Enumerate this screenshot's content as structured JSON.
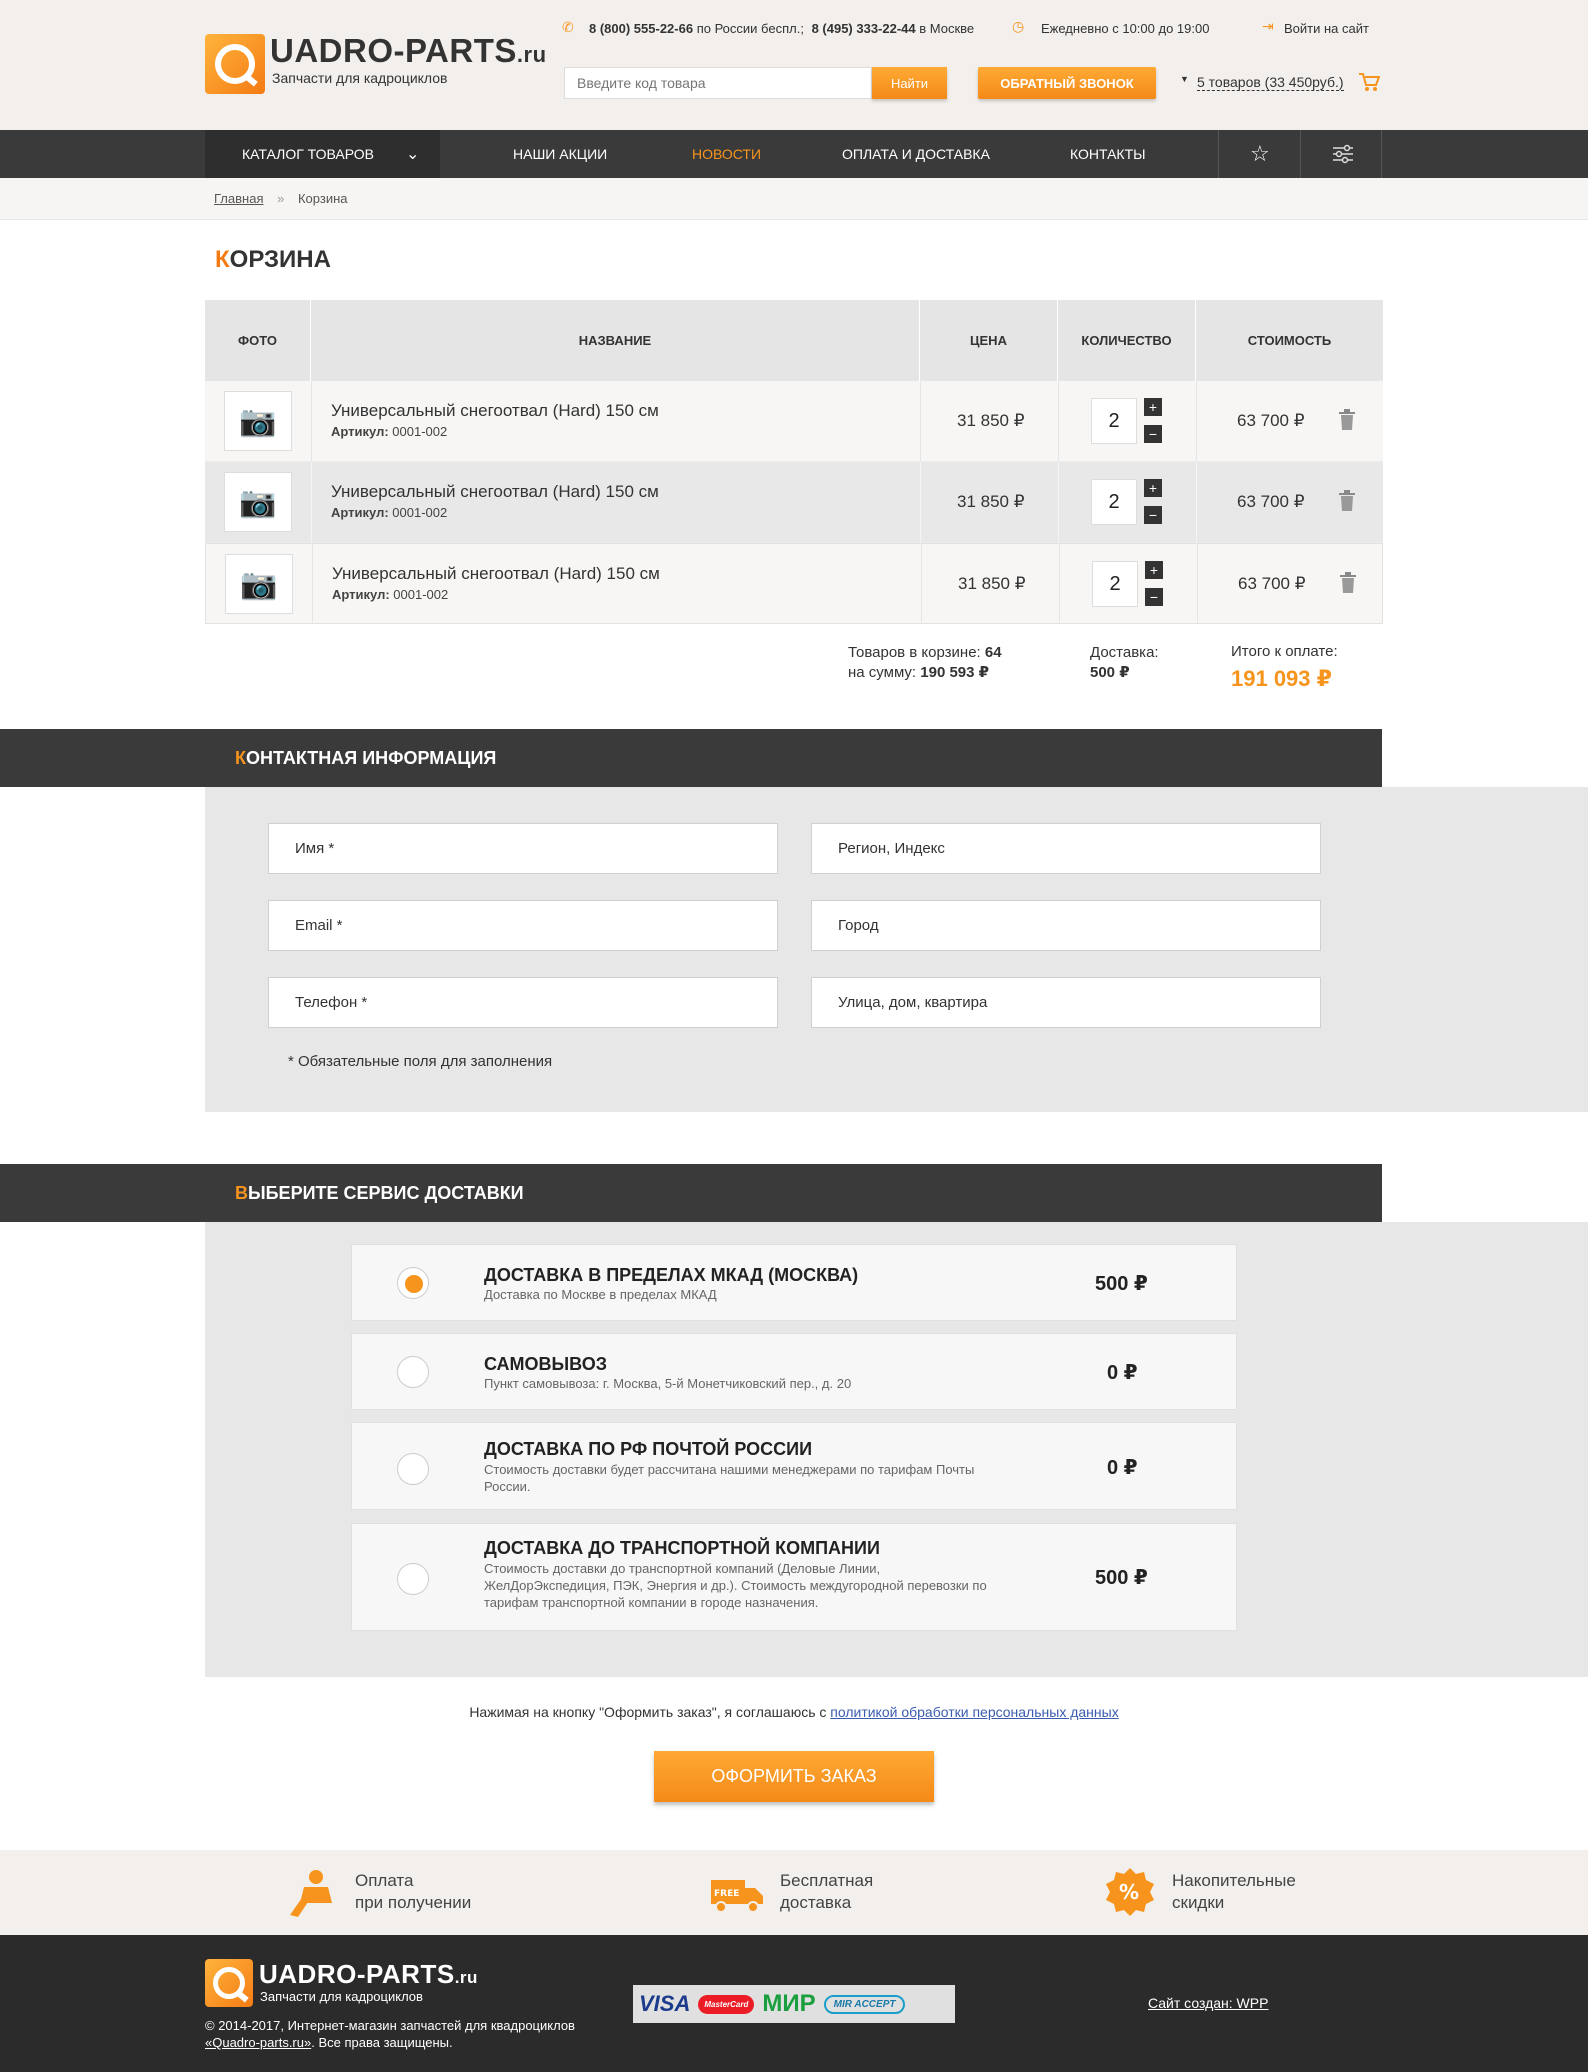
{
  "header": {
    "logo_title": "UADRO-PARTS",
    "logo_tld": ".ru",
    "logo_sub": "Запчасти для кадроциклов",
    "phone1": "8 (800) 555-22-66",
    "phone1_note": "по России беспл.;",
    "phone2": "8 (495) 333-22-44",
    "phone2_note": "в Москве",
    "hours": "Ежедневно с 10:00 до 19:00",
    "login": "Войти на сайт",
    "search_placeholder": "Введите код товара",
    "search_button": "Найти",
    "callback_button": "ОБРАТНЫЙ ЗВОНОК",
    "cart_summary": "5 товаров (33 450руб.)"
  },
  "nav": {
    "catalog": "КАТАЛОГ ТОВАРОВ",
    "items": [
      "НАШИ АКЦИИ",
      "НОВОСТИ",
      "ОПЛАТА И ДОСТАВКА",
      "КОНТАКТЫ"
    ]
  },
  "breadcrumb": {
    "home": "Главная",
    "sep": "»",
    "current": "Корзина"
  },
  "cart": {
    "title_first": "К",
    "title_rest": "ОРЗИНА",
    "headers": [
      "ФОТО",
      "НАЗВАНИЕ",
      "ЦЕНА",
      "КОЛИЧЕСТВО",
      "СТОИМОСТЬ"
    ],
    "rows": [
      {
        "name": "Универсальный снегоотвал (Hard) 150 см",
        "sku_label": "Артикул:",
        "sku": "0001-002",
        "price": "31 850 ₽",
        "qty": "2",
        "total": "63 700 ₽"
      },
      {
        "name": "Универсальный снегоотвал (Hard) 150 см",
        "sku_label": "Артикул:",
        "sku": "0001-002",
        "price": "31 850 ₽",
        "qty": "2",
        "total": "63 700 ₽"
      },
      {
        "name": "Универсальный снегоотвал (Hard) 150 см",
        "sku_label": "Артикул:",
        "sku": "0001-002",
        "price": "31 850 ₽",
        "qty": "2",
        "total": "63 700 ₽"
      }
    ],
    "summary": {
      "items_label": "Товаров в корзине:",
      "items_count": "64",
      "sum_label": "на сумму:",
      "sum_value": "190 593 ₽",
      "delivery_label": "Доставка:",
      "delivery_value": "500 ₽",
      "total_label": "Итого к оплате:",
      "total_value": "191 093 ₽"
    }
  },
  "contact": {
    "title_first": "К",
    "title_rest": "ОНТАКТНАЯ ИНФОРМАЦИЯ",
    "fields": [
      "Имя *",
      "Регион, Индекс",
      "Email *",
      "Город",
      "Телефон *",
      "Улица, дом, квартира"
    ],
    "note": "* Обязательные поля для заполнения"
  },
  "delivery": {
    "title_first": "В",
    "title_rest": "ЫБЕРИТЕ СЕРВИС ДОСТАВКИ",
    "options": [
      {
        "title": "ДОСТАВКА В ПРЕДЕЛАХ МКАД (МОСКВА)",
        "desc": "Доставка по Москве в пределах МКАД",
        "price": "500 ₽",
        "selected": true
      },
      {
        "title": "САМОВЫВОЗ",
        "desc": "Пункт самовывоза: г. Москва, 5-й Монетчиковский пер., д. 20",
        "price": "0 ₽",
        "selected": false
      },
      {
        "title": "ДОСТАВКА ПО РФ ПОЧТОЙ РОССИИ",
        "desc": "Стоимость доставки будет рассчитана нашими менеджерами по тарифам Почты России.",
        "price": "0 ₽",
        "selected": false
      },
      {
        "title": "ДОСТАВКА ДО ТРАНСПОРТНОЙ КОМПАНИИ",
        "desc": "Стоимость доставки до транспортной компаний (Деловые Линии, ЖелДорЭкспедиция, ПЭК, Энергия и др.). Стоимость междугородной перевозки по тарифам транспортной компании в городе назначения.",
        "price": "500 ₽",
        "selected": false
      }
    ]
  },
  "agreement": {
    "text": "Нажимая на кнопку \"Оформить заказ\", я соглашаюсь с",
    "link": "политикой обработки персональных данных"
  },
  "order_button": "ОФОРМИТЬ ЗАКАЗ",
  "benefits": [
    {
      "line1": "Оплата",
      "line2": "при получении"
    },
    {
      "line1": "Бесплатная",
      "line2": "доставка"
    },
    {
      "line1": "Накопительные",
      "line2": "скидки"
    }
  ],
  "footer": {
    "logo_title": "UADRO-PARTS",
    "logo_tld": ".ru",
    "logo_sub": "Запчасти для кадроциклов",
    "copyright1": "© 2014-2017, Интернет-магазин запчастей для квадроциклов",
    "copyright2_link": "«Quadro-parts.ru»",
    "copyright2_rest": ". Все права защищены.",
    "payments": [
      "VISA",
      "MasterCard",
      "МИР",
      "MIR ACCEPT"
    ],
    "credit": "Сайт создан:  WPP"
  }
}
